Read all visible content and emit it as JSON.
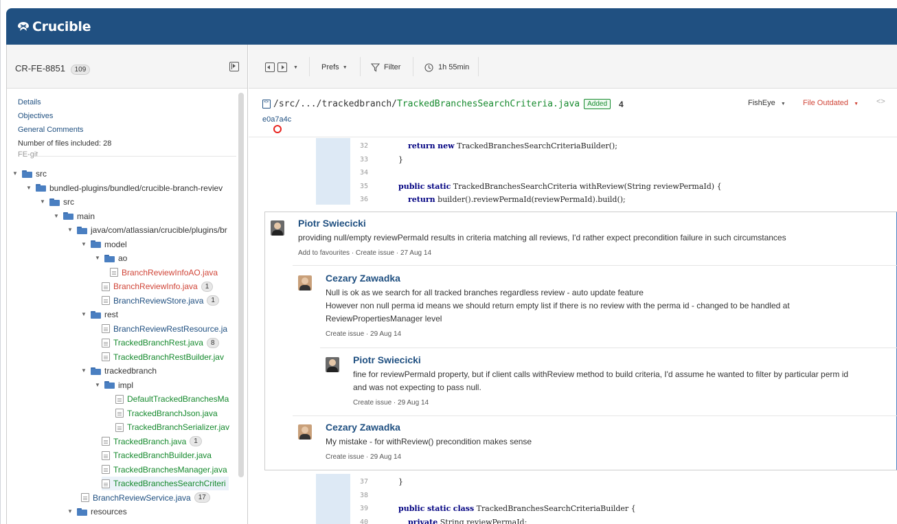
{
  "app": {
    "name": "Crucible",
    "header_color": "#205081"
  },
  "sidebar": {
    "review_key": "CR-FE-8851",
    "review_count": "109",
    "links": [
      "Details",
      "Objectives",
      "General Comments"
    ],
    "files_included": "Number of files included: 28",
    "repo": "FE-git",
    "tree": [
      {
        "type": "folder",
        "label": "src"
      },
      {
        "type": "folder",
        "label": "bundled-plugins/bundled/crucible-branch-reviev"
      },
      {
        "type": "folder",
        "label": "src"
      },
      {
        "type": "folder",
        "label": "main"
      },
      {
        "type": "folder",
        "label": "java/com/atlassian/crucible/plugins/br"
      },
      {
        "type": "folder",
        "label": "model"
      },
      {
        "type": "folder",
        "label": "ao"
      },
      {
        "type": "file",
        "label": "BranchReviewInfoAO.java",
        "status": "removed"
      },
      {
        "type": "file",
        "label": "BranchReviewInfo.java",
        "status": "removed",
        "count": "1"
      },
      {
        "type": "file",
        "label": "BranchReviewStore.java",
        "status": "modified",
        "count": "1"
      },
      {
        "type": "folder",
        "label": "rest"
      },
      {
        "type": "file",
        "label": "BranchReviewRestResource.ja",
        "status": "modified"
      },
      {
        "type": "file",
        "label": "TrackedBranchRest.java",
        "status": "added",
        "count": "8"
      },
      {
        "type": "file",
        "label": "TrackedBranchRestBuilder.jav",
        "status": "added"
      },
      {
        "type": "folder",
        "label": "trackedbranch"
      },
      {
        "type": "folder",
        "label": "impl"
      },
      {
        "type": "file",
        "label": "DefaultTrackedBranchesMa",
        "status": "added"
      },
      {
        "type": "file",
        "label": "TrackedBranchJson.java",
        "status": "added"
      },
      {
        "type": "file",
        "label": "TrackedBranchSerializer.jav",
        "status": "added"
      },
      {
        "type": "file",
        "label": "TrackedBranch.java",
        "status": "added",
        "count": "1"
      },
      {
        "type": "file",
        "label": "TrackedBranchBuilder.java",
        "status": "added"
      },
      {
        "type": "file",
        "label": "TrackedBranchesManager.java",
        "status": "added"
      },
      {
        "type": "file",
        "label": "TrackedBranchesSearchCriteri",
        "status": "added",
        "selected": true
      },
      {
        "type": "file",
        "label": "BranchReviewService.java",
        "status": "modified",
        "count": "17"
      },
      {
        "type": "folder",
        "label": "resources"
      }
    ]
  },
  "toolbar": {
    "prefs": "Prefs",
    "filter": "Filter",
    "time": "1h 55min"
  },
  "file_header": {
    "path_prefix": "/src/.../trackedbranch/",
    "file_name": "TrackedBranchesSearchCriteria.java",
    "status_badge": "Added",
    "comment_count": "4",
    "revision": "e0a7a4c",
    "fisheye": "FishEye",
    "outdated": "File Outdated"
  },
  "code_top": [
    {
      "ln": "32",
      "code": "        return new TrackedBranchesSearchCriteriaBuilder();"
    },
    {
      "ln": "33",
      "code": "    }"
    },
    {
      "ln": "34",
      "code": ""
    },
    {
      "ln": "35",
      "code": "    public static TrackedBranchesSearchCriteria withReview(String reviewPermaId) {"
    },
    {
      "ln": "36",
      "code": "        return builder().reviewPermaId(reviewPermaId).build();"
    }
  ],
  "code_bottom": [
    {
      "ln": "37",
      "code": "    }"
    },
    {
      "ln": "38",
      "code": ""
    },
    {
      "ln": "39",
      "code": "    public static class TrackedBranchesSearchCriteriaBuilder {"
    },
    {
      "ln": "40",
      "code": "        private String reviewPermaId;"
    }
  ],
  "comments": [
    {
      "author": "Piotr Swiecicki",
      "lines": [
        "providing null/empty reviewPermaId results in criteria matching all reviews, I'd rather expect precondition failure in such circumstances"
      ],
      "meta": "Add to favourites  ·  Create issue  ·  27 Aug 14"
    },
    {
      "author": "Cezary Zawadka",
      "lines": [
        "Null is ok as we search for all tracked branches regardless review - auto update feature",
        "However non null perma id means we should return empty list if there is no review with the perma id - changed to be handled at",
        "ReviewPropertiesManager level"
      ],
      "meta": "Create issue  ·  29 Aug 14"
    },
    {
      "author": "Piotr Swiecicki",
      "lines": [
        "fine for reviewPermaId property, but if client calls withReview method to build criteria, I'd assume he wanted to filter by particular perm id",
        "and was not expecting to pass null."
      ],
      "meta": "Create issue  ·  29 Aug 14"
    },
    {
      "author": "Cezary Zawadka",
      "lines": [
        "My mistake - for withReview() precondition makes sense"
      ],
      "meta": "Create issue  ·  29 Aug 14"
    }
  ]
}
